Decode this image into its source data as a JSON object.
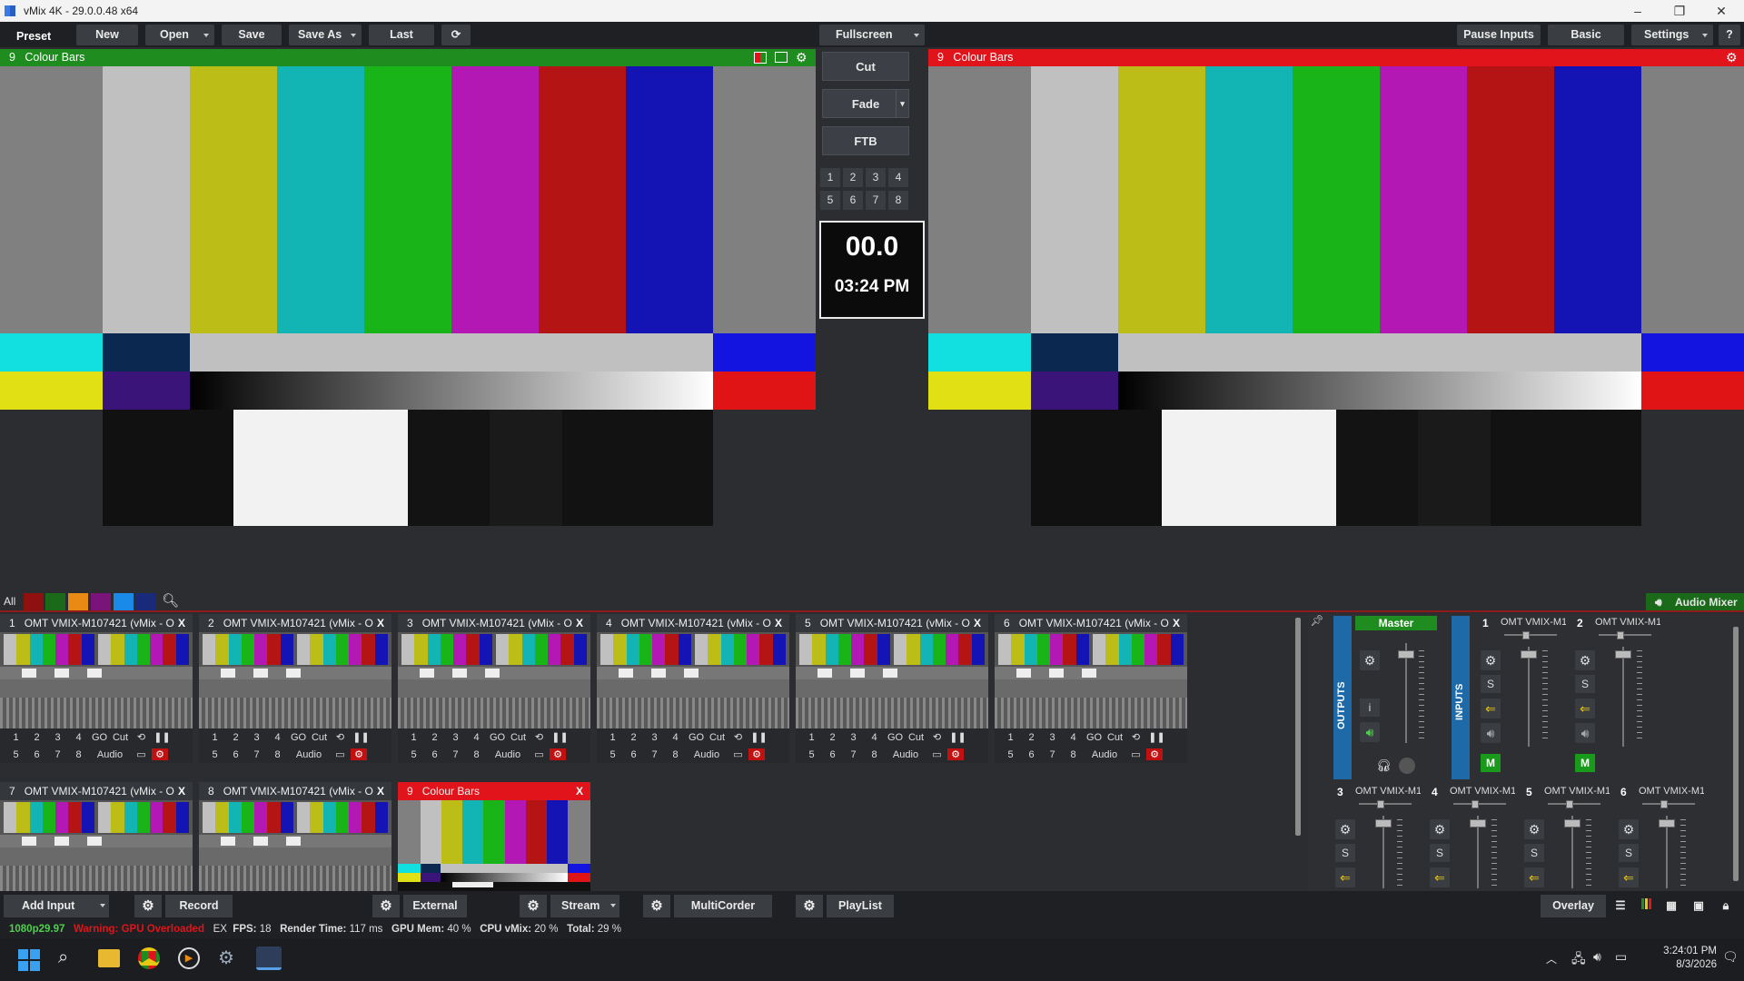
{
  "window": {
    "title": "vMix 4K - 29.0.0.48 x64"
  },
  "toolbar": {
    "preset": "Preset",
    "new": "New",
    "open": "Open",
    "save": "Save",
    "save_as": "Save As",
    "last": "Last",
    "fullscreen": "Fullscreen",
    "pause_inputs": "Pause Inputs",
    "basic": "Basic",
    "settings": "Settings",
    "help": "?"
  },
  "preview": {
    "number": "9",
    "title": "Colour Bars",
    "color": "#1e8c1e"
  },
  "program": {
    "number": "9",
    "title": "Colour Bars",
    "color": "#e0141a"
  },
  "transitions": {
    "cut": "Cut",
    "fade": "Fade",
    "ftb": "FTB",
    "numbers": [
      "1",
      "2",
      "3",
      "4",
      "5",
      "6",
      "7",
      "8"
    ]
  },
  "clock": {
    "countdown": "00.0",
    "time": "03:24 PM"
  },
  "filter": {
    "all": "All"
  },
  "audio_mixer_label": "Audio Mixer",
  "inputs": [
    {
      "num": "1",
      "title": "OMT VMIX-M107421 (vMix - O"
    },
    {
      "num": "2",
      "title": "OMT VMIX-M107421 (vMix - O"
    },
    {
      "num": "3",
      "title": "OMT VMIX-M107421 (vMix - O"
    },
    {
      "num": "4",
      "title": "OMT VMIX-M107421 (vMix - O"
    },
    {
      "num": "5",
      "title": "OMT VMIX-M107421 (vMix - O"
    },
    {
      "num": "6",
      "title": "OMT VMIX-M107421 (vMix - O"
    },
    {
      "num": "7",
      "title": "OMT VMIX-M107421 (vMix - O"
    },
    {
      "num": "8",
      "title": "OMT VMIX-M107421 (vMix - O"
    },
    {
      "num": "9",
      "title": "Colour Bars"
    }
  ],
  "input_controls": {
    "go": "GO",
    "cut": "Cut",
    "audio": "Audio",
    "close": "X"
  },
  "mixer": {
    "outputs": "OUTPUTS",
    "inputs": "INPUTS",
    "master": "Master",
    "info": "i",
    "solo": "S",
    "mute": "M",
    "channels": [
      {
        "num": "1",
        "name": "OMT VMIX-M1"
      },
      {
        "num": "2",
        "name": "OMT VMIX-M1"
      },
      {
        "num": "3",
        "name": "OMT VMIX-M1"
      },
      {
        "num": "4",
        "name": "OMT VMIX-M1"
      },
      {
        "num": "5",
        "name": "OMT VMIX-M1"
      },
      {
        "num": "6",
        "name": "OMT VMIX-M1"
      }
    ]
  },
  "bottom": {
    "add_input": "Add Input",
    "record": "Record",
    "external": "External",
    "stream": "Stream",
    "multicorder": "MultiCorder",
    "playlist": "PlayList",
    "overlay": "Overlay"
  },
  "status": {
    "format": "1080p29.97",
    "warning": "Warning: GPU Overloaded",
    "ex": "EX",
    "fps_label": "FPS:",
    "fps": "18",
    "render_label": "Render Time:",
    "render": "117 ms",
    "gpu_label": "GPU Mem:",
    "gpu": "40 %",
    "cpu_label": "CPU vMix:",
    "cpu": "20 %",
    "total_label": "Total:",
    "total": "29 %"
  },
  "taskbar": {
    "time": "3:24:01 PM",
    "date": "8/3/2026"
  },
  "colors": {
    "bars_top": [
      "#c0c0c0",
      "#bdbd18",
      "#12b4b4",
      "#18b418",
      "#b418b4",
      "#b41414",
      "#1414b4"
    ],
    "preview_green": "#1e8c1e",
    "program_red": "#e0141a",
    "mute_green": "#1a9a1a"
  }
}
